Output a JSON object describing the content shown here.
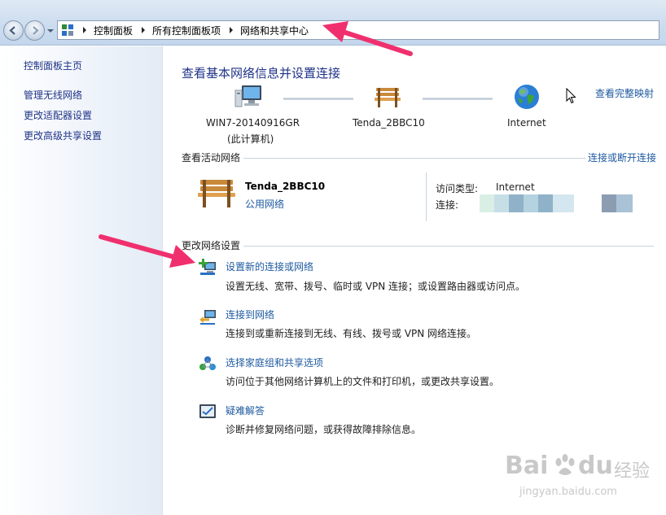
{
  "address": {
    "breadcrumbs": [
      "控制面板",
      "所有控制面板项",
      "网络和共享中心"
    ]
  },
  "sidebar": {
    "items": [
      {
        "label": "控制面板主页"
      },
      {
        "label": "管理无线网络"
      },
      {
        "label": "更改适配器设置"
      },
      {
        "label": "更改高级共享设置"
      }
    ]
  },
  "main": {
    "title": "查看基本网络信息并设置连接",
    "map_link": "查看完整映射",
    "nodes": [
      {
        "label_line1": "WIN7-20140916GR",
        "label_line2": "(此计算机)",
        "icon": "computer-icon"
      },
      {
        "label_line1": "Tenda_2BBC10",
        "icon": "bench-icon"
      },
      {
        "label_line1": "Internet",
        "icon": "globe-icon"
      }
    ],
    "active": {
      "section_title": "查看活动网络",
      "connect_link": "连接或断开连接",
      "network_name": "Tenda_2BBC10",
      "network_type": "公用网络",
      "access_type_label": "访问类型:",
      "access_type_value": "Internet",
      "connection_label": "连接:"
    },
    "settings": {
      "section_title": "更改网络设置",
      "tasks": [
        {
          "title": "设置新的连接或网络",
          "desc": "设置无线、宽带、拨号、临时或 VPN 连接；或设置路由器或访问点。",
          "icon": "new-connection-icon"
        },
        {
          "title": "连接到网络",
          "desc": "连接到或重新连接到无线、有线、拨号或 VPN 网络连接。",
          "icon": "connect-network-icon"
        },
        {
          "title": "选择家庭组和共享选项",
          "desc": "访问位于其他网络计算机上的文件和打印机，或更改共享设置。",
          "icon": "homegroup-icon"
        },
        {
          "title": "疑难解答",
          "desc": "诊断并修复网络问题，或获得故障排除信息。",
          "icon": "troubleshoot-icon"
        }
      ]
    }
  },
  "watermark": {
    "brand": "Bai",
    "brand2": "du",
    "brand_cn": "经验",
    "site": "jingyan.baidu.com"
  },
  "colors": {
    "link": "#1e5aa0",
    "title": "#1e3287",
    "annotation_arrow": "#f0306e"
  }
}
